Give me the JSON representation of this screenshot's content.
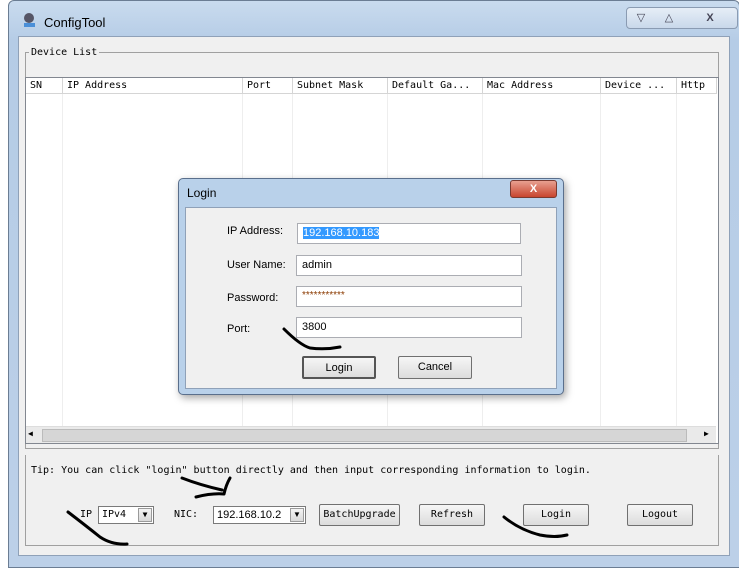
{
  "window": {
    "title": "ConfigTool",
    "minimize": "▽",
    "maximize": "△",
    "close": "X"
  },
  "device_list": {
    "legend": "Device List",
    "columns": [
      "SN",
      "IP Address",
      "Port",
      "Subnet Mask",
      "Default Ga...",
      "Mac Address",
      "Device ...",
      "Http"
    ],
    "rows": []
  },
  "tip": "Tip: You can click \"login\" button directly and then input corresponding information to login.",
  "bottom": {
    "ip_label": "IP",
    "ip_value": "IPv4",
    "nic_label": "NIC:",
    "nic_value": "192.168.10.2",
    "batch_upgrade": "BatchUpgrade",
    "refresh": "Refresh",
    "login": "Login",
    "logout": "Logout"
  },
  "login_dialog": {
    "title": "Login",
    "close": "X",
    "ip_label": "IP Address:",
    "ip_value": "192.168.10.183",
    "user_label": "User Name:",
    "user_value": "admin",
    "password_label": "Password:",
    "password_value": "***********",
    "port_label": "Port:",
    "port_value": "3800",
    "login": "Login",
    "cancel": "Cancel"
  },
  "colors": {
    "selection": "#3399ff",
    "title_bar": "#b9d1ea",
    "annotation_ink": "#000000"
  }
}
